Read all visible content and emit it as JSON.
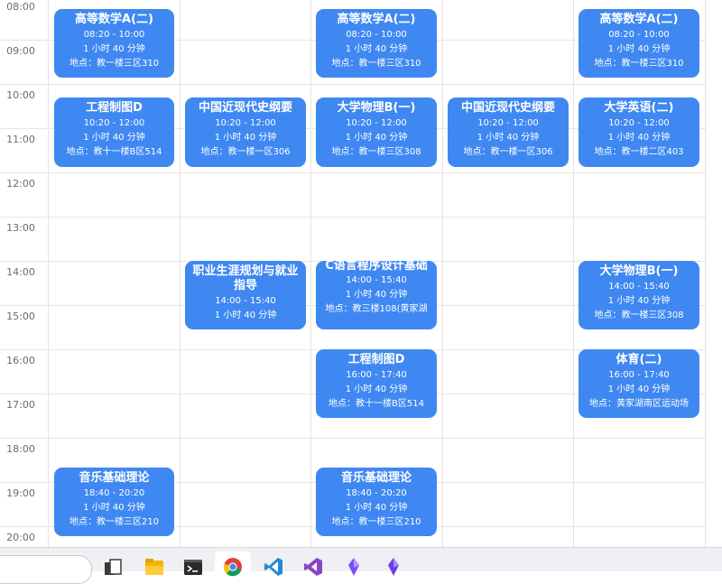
{
  "time_labels": [
    "08:00",
    "09:00",
    "10:00",
    "11:00",
    "12:00",
    "13:00",
    "14:00",
    "15:00",
    "16:00",
    "17:00",
    "18:00",
    "19:00",
    "20:00"
  ],
  "events": [
    {
      "title": "高等数学A(二)",
      "time": "08:20 - 10:00",
      "duration": "1 小时 40 分钟",
      "location": "地点：教一楼三区310"
    },
    {
      "title": "工程制图D",
      "time": "10:20 - 12:00",
      "duration": "1 小时 40 分钟",
      "location": "地点：教十一楼B区514"
    },
    {
      "title": "音乐基础理论",
      "time": "18:40 - 20:20",
      "duration": "1 小时 40 分钟",
      "location": "地点：教一楼三区210"
    },
    {
      "title": "中国近现代史纲要",
      "time": "10:20 - 12:00",
      "duration": "1 小时 40 分钟",
      "location": "地点：教一楼一区306"
    },
    {
      "title": "职业生涯规划与就业指导",
      "time": "14:00 - 15:40",
      "duration": "1 小时 40 分钟",
      "location": ""
    },
    {
      "title": "高等数学A(二)",
      "time": "08:20 - 10:00",
      "duration": "1 小时 40 分钟",
      "location": "地点：教一楼三区310"
    },
    {
      "title": "大学物理B(一)",
      "time": "10:20 - 12:00",
      "duration": "1 小时 40 分钟",
      "location": "地点：教一楼三区308"
    },
    {
      "title": "C语言程序设计基础",
      "time": "14:00 - 15:40",
      "duration": "1 小时 40 分钟",
      "location": "地点：教三楼108(黄家湖"
    },
    {
      "title": "工程制图D",
      "time": "16:00 - 17:40",
      "duration": "1 小时 40 分钟",
      "location": "地点：教十一楼B区514"
    },
    {
      "title": "音乐基础理论",
      "time": "18:40 - 20:20",
      "duration": "1 小时 40 分钟",
      "location": "地点：教一楼三区210"
    },
    {
      "title": "中国近现代史纲要",
      "time": "10:20 - 12:00",
      "duration": "1 小时 40 分钟",
      "location": "地点：教一楼一区306"
    },
    {
      "title": "高等数学A(二)",
      "time": "08:20 - 10:00",
      "duration": "1 小时 40 分钟",
      "location": "地点：教一楼三区310"
    },
    {
      "title": "大学英语(二)",
      "time": "10:20 - 12:00",
      "duration": "1 小时 40 分钟",
      "location": "地点：教一楼二区403"
    },
    {
      "title": "大学物理B(一)",
      "time": "14:00 - 15:40",
      "duration": "1 小时 40 分钟",
      "location": "地点：教一楼三区308"
    },
    {
      "title": "体育(二)",
      "time": "16:00 - 17:40",
      "duration": "1 小时 40 分钟",
      "location": "地点：黄家湖南区运动场"
    }
  ],
  "taskbar": {
    "icons": [
      "task-view-icon",
      "file-explorer-icon",
      "terminal-icon",
      "chrome-icon",
      "vscode-icon",
      "visual-studio-icon",
      "app-crystal-icon",
      "app-crystal-icon-2"
    ]
  },
  "colors": {
    "event_bg": "#3f88f2",
    "grid_line": "#e6e6e6"
  }
}
